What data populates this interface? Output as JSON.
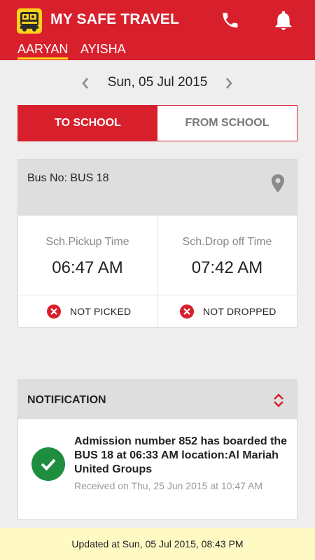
{
  "app": {
    "title": "MY SAFE TRAVEL",
    "icons": [
      "school-bus-logo-icon",
      "phone-icon",
      "bell-icon"
    ],
    "colors": {
      "primary": "#d8202c",
      "accent": "#ffd21e",
      "success": "#1e8e3e",
      "footer_bg": "#fff9c4"
    }
  },
  "children": [
    {
      "name": "AARYAN",
      "selected": true
    },
    {
      "name": "AYISHA",
      "selected": false
    }
  ],
  "date": {
    "label": "Sun, 05 Jul 2015"
  },
  "direction": {
    "to_school": "TO SCHOOL",
    "from_school": "FROM SCHOOL",
    "selected": "TO SCHOOL"
  },
  "bus": {
    "number_label": "Bus No: BUS 18",
    "pickup_label": "Sch.Pickup Time",
    "pickup_time": "06:47 AM",
    "dropoff_label": "Sch.Drop off Time",
    "dropoff_time": "07:42 AM",
    "pickup_status": "NOT PICKED",
    "dropoff_status": "NOT DROPPED"
  },
  "notification": {
    "title": "NOTIFICATION",
    "message": "Admission number 852 has boarded the BUS 18 at 06:33 AM location:Al Mariah United Groups",
    "received": "Received on Thu, 25 Jun 2015 at 10:47 AM"
  },
  "footer": {
    "updated": "Updated at Sun, 05 Jul 2015, 08:43 PM"
  }
}
